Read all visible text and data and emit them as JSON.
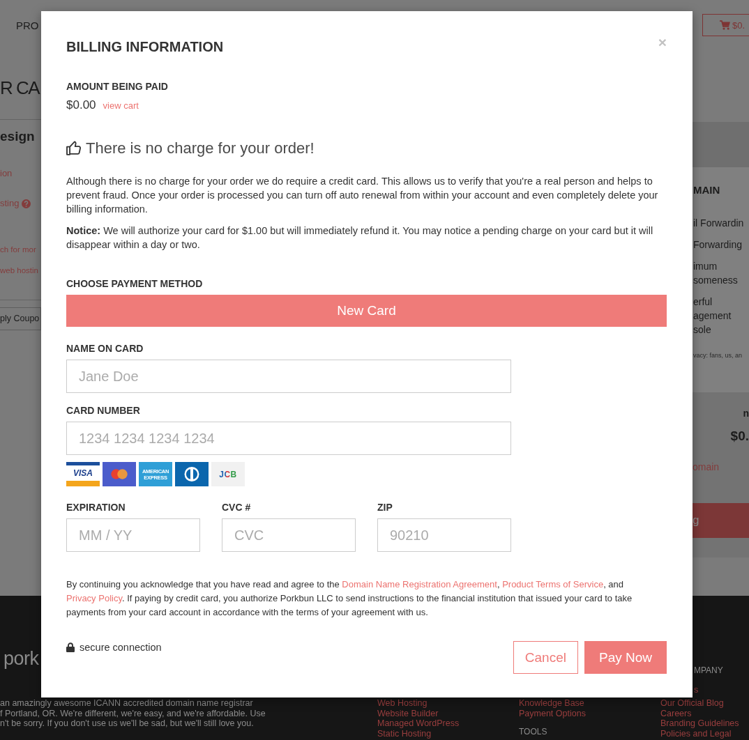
{
  "background": {
    "nav_item": "PRO",
    "cart_button": "$0.",
    "title": "R CA",
    "cart_item": {
      "name": "esign",
      "options": [
        {
          "text": "ion",
          "help": false
        },
        {
          "text": "sting",
          "help": true
        }
      ],
      "notes": [
        "ch for mor",
        "web hostin"
      ]
    },
    "coupon_button": "ply Coupo",
    "domain_panel": {
      "heading": "MAIN",
      "features": [
        [
          "il Forwardin"
        ],
        [
          "Forwarding"
        ],
        [
          "imum",
          "someness"
        ],
        [
          "erful",
          "agement",
          "sole"
        ]
      ],
      "privacy_note": "vacy: fans, us, an"
    },
    "summary": {
      "label": "n",
      "total": "$0.",
      "link": "omain",
      "checkout_button": "g"
    }
  },
  "footer": {
    "logo": "pork",
    "about": [
      "an amazingly awesome ICANN accredited domain name registrar",
      "f Portland, OR. We're different, we're easy, and we're affordable. Use",
      "n't be sorry. If you don't use us we'll be sad, but we'll still love you."
    ],
    "company_heading": "MPANY",
    "company_link": "s",
    "columns": [
      [
        {
          "kind": "link",
          "text": "Web Hosting"
        },
        {
          "kind": "link",
          "text": "Website Builder"
        },
        {
          "kind": "link",
          "text": "Managed WordPress"
        },
        {
          "kind": "link",
          "text": "Static Hosting"
        }
      ],
      [
        {
          "kind": "link",
          "text": "Knowledge Base"
        },
        {
          "kind": "link",
          "text": "Payment Options"
        },
        {
          "kind": "heading",
          "text": "TOOLS"
        }
      ],
      [
        {
          "kind": "link",
          "text": "Our Official Blog"
        },
        {
          "kind": "link",
          "text": "Careers"
        },
        {
          "kind": "link",
          "text": "Branding Guidelines"
        },
        {
          "kind": "link",
          "text": "Policies and Legal"
        }
      ]
    ]
  },
  "modal": {
    "title": "BILLING INFORMATION",
    "close": "×",
    "amount_label": "AMOUNT BEING PAID",
    "amount": "$0.00",
    "view_cart": "view cart",
    "no_charge": "There is no charge for your order!",
    "explanation": "Although there is no charge for your order we do require a credit card. This allows us to verify that you're a real person and helps to prevent fraud. Once your order is processed you can turn off auto renewal from within your account and even completely delete your billing information.",
    "notice": "**Notice:** We will authorize your card for $1.00 but will immediately refund it. You may notice a pending charge on your card but it will disappear within a day or two.",
    "payment_method_label": "CHOOSE PAYMENT METHOD",
    "payment_methods": [
      {
        "label": "New Card",
        "selected": true
      }
    ],
    "fields": [
      {
        "label": "NAME ON CARD",
        "placeholder": "Jane Doe"
      },
      {
        "label": "CARD NUMBER",
        "placeholder": "1234 1234 1234 1234"
      }
    ],
    "card_brands": [
      {
        "kind": "visa",
        "label": "VISA"
      },
      {
        "kind": "mastercard"
      },
      {
        "kind": "amex",
        "label": "AMERICAN EXPRESS"
      },
      {
        "kind": "diners"
      },
      {
        "kind": "jcb",
        "label": "JCB"
      }
    ],
    "short_fields": [
      {
        "label": "EXPIRATION",
        "placeholder": "MM / YY"
      },
      {
        "label": "CVC #",
        "placeholder": "CVC"
      },
      {
        "label": "ZIP",
        "placeholder": "90210"
      }
    ],
    "terms": [
      {
        "kind": "text",
        "text": "By continuing you acknowledge that you have read and agree to the "
      },
      {
        "kind": "link",
        "text": "Domain Name Registration Agreement"
      },
      {
        "kind": "text",
        "text": ", "
      },
      {
        "kind": "link",
        "text": "Product Terms of Service"
      },
      {
        "kind": "text",
        "text": ", and "
      },
      {
        "kind": "link",
        "text": "Privacy Policy"
      },
      {
        "kind": "text",
        "text": ". If paying by credit card, you authorize Porkbun LLC to send instructions to the financial institution that issued your card to take payments from your card account in accordance with the terms of your agreement with us."
      }
    ],
    "secure": "secure connection",
    "buttons": [
      {
        "label": "Cancel",
        "kind": "cancel"
      },
      {
        "label": "Pay Now",
        "kind": "submit"
      }
    ]
  }
}
